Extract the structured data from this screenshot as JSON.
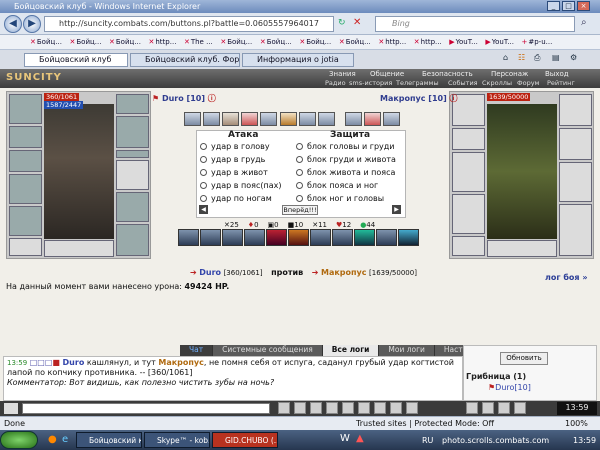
{
  "browser": {
    "title": "Бойцовский клуб - Windows Internet Explorer",
    "url": "http://suncity.combats.com/buttons.pl?battle=0.0605557964017",
    "search_placeholder": "Bing",
    "favorites": [
      "Бойц...",
      "Бойц...",
      "Бойц...",
      "http...",
      "The ...",
      "Бойц...",
      "Бойц...",
      "Бойц...",
      "Бойц...",
      "http...",
      "http...",
      "YouT...",
      "YouT...",
      "#p-u..."
    ],
    "tabs": [
      "Бойцовский клуб",
      "Бойцовский клуб. Форум...",
      "Информация о jotia"
    ]
  },
  "game": {
    "logo": "SUNCITY",
    "top_menu": [
      "Знания",
      "Общение",
      "Безопасность",
      "Персонаж",
      "Выход"
    ],
    "sub_menu": [
      "Радио",
      "sms-история",
      "Телеграммы",
      "События",
      "Скроллы",
      "Форум",
      "Рейтинг"
    ],
    "player": {
      "name": "Duro",
      "level": "[10]",
      "hp": "360/1061",
      "mana": "1587/2447"
    },
    "enemy": {
      "name": "Макропус",
      "level": "[10]",
      "hp": "1639/50000"
    },
    "attack_title": "Атака",
    "defense_title": "Защита",
    "attack_options": [
      "удар в голову",
      "удар в грудь",
      "удар в живот",
      "удар в пояс(пах)",
      "удар по ногам"
    ],
    "defense_options": [
      "блок головы и груди",
      "блок груди и живота",
      "блок живота и пояса",
      "блок пояса и ног",
      "блок ног и головы"
    ],
    "forward_button": "Вперёд!!!",
    "stats": [
      "25",
      "0",
      "0",
      "10",
      "11",
      "12",
      "44"
    ],
    "vs_player": "Duro",
    "vs_player_hp": "[360/1061]",
    "vs_word": "против",
    "vs_enemy": "Макропус",
    "vs_enemy_hp": "[1639/50000]",
    "damage_text": "На данный момент вами нанесено урона:",
    "damage_value": "49424 HP.",
    "battle_log": "лог боя »"
  },
  "chat": {
    "tabs": [
      "Чат",
      "Системные сообщения",
      "Все логи",
      "Мои логи",
      "Настройки"
    ],
    "time": "13:59",
    "author": "Duro",
    "line1a": "кашлянул, и тут",
    "enemy": "Макропус",
    "line1b": ", не помня себя от испуга, саданул грубый удар когтистой",
    "line2": "лапой по копчику противника. -- [360/1061]",
    "line3": "Комментатор: Вот видишь, как полезно чистить зубы на ночь?",
    "refresh": "Обновить",
    "room": "Грибница (1)",
    "room_member": "Duro[10]",
    "clock": "13:59"
  },
  "status": {
    "left": "Done",
    "zone": "Trusted sites | Protected Mode: Off",
    "zoom": "100%"
  },
  "taskbar": {
    "items": [
      "Бойцовский клуб ...",
      "Skype™ - kob...",
      "GID.CHUBO (..."
    ],
    "lang": "RU",
    "clock": "13:59",
    "watermark": "photo.scrolls.combats.com"
  }
}
